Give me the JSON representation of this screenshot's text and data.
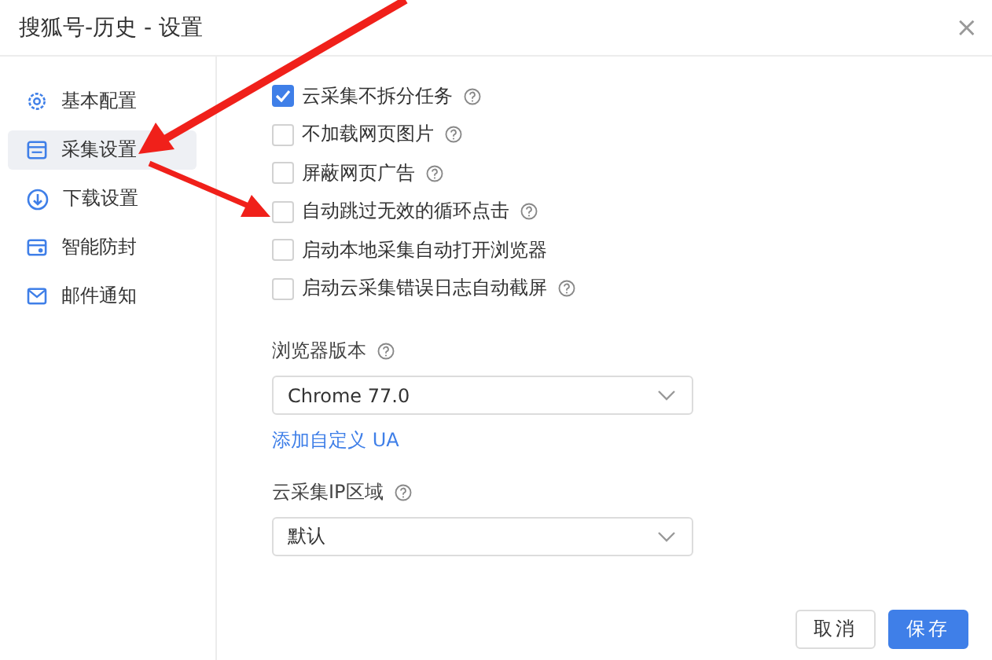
{
  "window": {
    "title": "搜狐号-历史 - 设置",
    "close": "×"
  },
  "sidebar": {
    "items": [
      {
        "label": "基本配置",
        "selected": false
      },
      {
        "label": "采集设置",
        "selected": true
      },
      {
        "label": "下载设置",
        "selected": false
      },
      {
        "label": "智能防封",
        "selected": false
      },
      {
        "label": "邮件通知",
        "selected": false
      }
    ]
  },
  "options": [
    {
      "label": "云采集不拆分任务",
      "checked": true,
      "help": true
    },
    {
      "label": "不加载网页图片",
      "checked": false,
      "help": true
    },
    {
      "label": "屏蔽网页广告",
      "checked": false,
      "help": true
    },
    {
      "label": "自动跳过无效的循环点击",
      "checked": false,
      "help": true
    },
    {
      "label": "启动本地采集自动打开浏览器",
      "checked": false,
      "help": false
    },
    {
      "label": "启动云采集错误日志自动截屏",
      "checked": false,
      "help": true
    }
  ],
  "browser_version": {
    "label": "浏览器版本",
    "help": true,
    "value": "Chrome 77.0"
  },
  "custom_ua_link": "添加自定义 UA",
  "cloud_ip_region": {
    "label": "云采集IP区域",
    "help": true,
    "value": "默认"
  },
  "buttons": [
    {
      "label": "取消",
      "kind": "secondary"
    },
    {
      "label": "保存",
      "kind": "primary"
    }
  ]
}
